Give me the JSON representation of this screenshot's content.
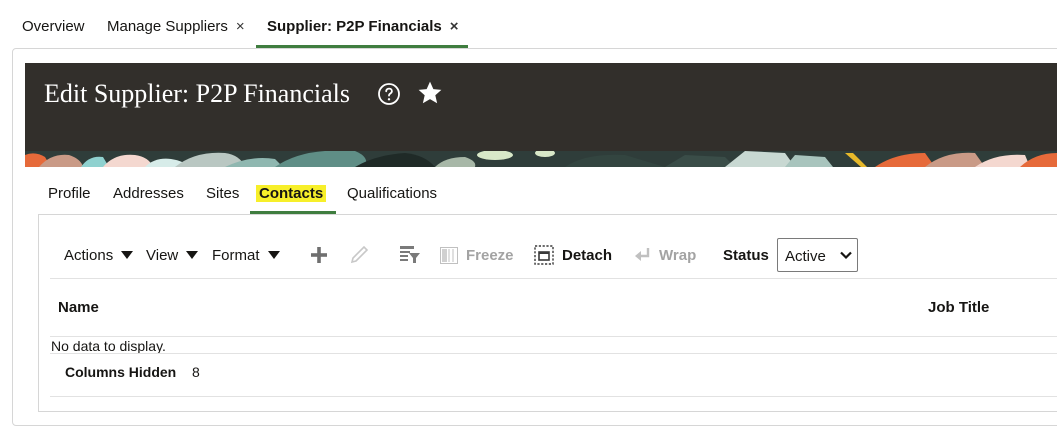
{
  "top_tabs": {
    "overview": "Overview",
    "manage_suppliers": "Manage Suppliers",
    "supplier": "Supplier: P2P Financials",
    "close_glyph": "×"
  },
  "banner": {
    "title": "Edit Supplier: P2P Financials",
    "help_icon": "help-circle-icon",
    "favorite_icon": "star-icon"
  },
  "sub_tabs": {
    "profile": "Profile",
    "addresses": "Addresses",
    "sites": "Sites",
    "contacts": "Contacts",
    "qualifications": "Qualifications",
    "active": "Contacts",
    "highlight_color": "#f7ef2a"
  },
  "toolbar": {
    "actions": "Actions",
    "view": "View",
    "format": "Format",
    "add_icon": "plus-icon",
    "edit_icon": "pencil-icon",
    "query_icon": "query-by-example-icon",
    "freeze": "Freeze",
    "detach": "Detach",
    "wrap": "Wrap",
    "status_label": "Status",
    "status_value": "Active"
  },
  "table": {
    "columns": [
      "Name",
      "Job Title"
    ],
    "empty_message": "No data to display.",
    "columns_hidden_label": "Columns Hidden",
    "columns_hidden_count": "8"
  },
  "colors": {
    "accent_green": "#3f7d3f",
    "banner_bg": "#322f2b"
  }
}
